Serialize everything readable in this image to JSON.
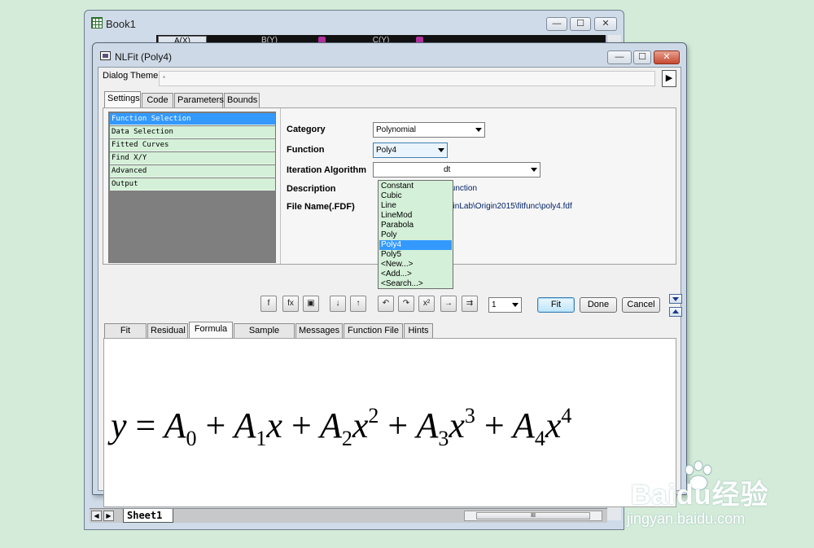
{
  "book1": {
    "title": "Book1",
    "columns": [
      {
        "label": "A(X)"
      },
      {
        "label": "B(Y)"
      },
      {
        "label": "C(Y)"
      }
    ],
    "sheet_tab": "Sheet1",
    "hscroll_thumb": "III",
    "window_buttons": {
      "minimize": "—",
      "maximize": "☐",
      "close": "✕"
    }
  },
  "nlfit": {
    "title": "NLFit (Poly4)",
    "window_buttons": {
      "minimize": "—",
      "maximize": "☐",
      "close": "✕"
    },
    "dialog_theme_label": "Dialog Theme",
    "dialog_theme_value": "*",
    "dialog_theme_arrow": "▶",
    "top_tabs": [
      "Settings",
      "Code",
      "Parameters",
      "Bounds"
    ],
    "tree_items": [
      "Function Selection",
      "Data Selection",
      "Fitted Curves",
      "Find X/Y",
      "Advanced",
      "Output"
    ],
    "fields": {
      "category_label": "Category",
      "category_value": "Polynomial",
      "function_label": "Function",
      "function_value": "Poly4",
      "iteration_label": "Iteration Algorithm",
      "iteration_value_visible": "dt",
      "description_label": "Description",
      "description_value_visible": "function",
      "filename_label": "File Name(.FDF)",
      "filename_value_visible": "ginLab\\Origin2015\\fitfunc\\poly4.fdf"
    },
    "function_options": [
      "Constant",
      "Cubic",
      "Line",
      "LineMod",
      "Parabola",
      "Poly",
      "Poly4",
      "Poly5",
      "<New...>",
      "<Add...>",
      "<Search...>"
    ],
    "selected_function": "Poly4",
    "toolbar_icons": [
      "fx-new-icon",
      "fx-edit-icon",
      "save-icon",
      "sort-down-icon",
      "sort-up-icon",
      "undo-icon",
      "redo-icon",
      "chi-square-icon",
      "step-icon",
      "iterate-icon"
    ],
    "toolbar_icon_text": [
      "f",
      "fx",
      "▣",
      "↓",
      "↑",
      "↶",
      "↷",
      "x²",
      "→",
      "⇉"
    ],
    "iteration_count": "1",
    "buttons": {
      "fit": "Fit",
      "done": "Done",
      "cancel": "Cancel"
    },
    "bottom_tabs": [
      "Fit Curve",
      "Residual",
      "Formula",
      "Sample Curve",
      "Messages",
      "Function File",
      "Hints"
    ],
    "active_bottom_tab": "Formula",
    "formula": {
      "y": "y",
      "eq": "=",
      "terms": [
        {
          "coef": "A",
          "sub": "0",
          "var": "",
          "pow": ""
        },
        {
          "coef": "A",
          "sub": "1",
          "var": "x",
          "pow": ""
        },
        {
          "coef": "A",
          "sub": "2",
          "var": "x",
          "pow": "2"
        },
        {
          "coef": "A",
          "sub": "3",
          "var": "x",
          "pow": "3"
        },
        {
          "coef": "A",
          "sub": "4",
          "var": "x",
          "pow": "4"
        }
      ],
      "plus": "+"
    }
  },
  "watermark": {
    "main": "Baidu经验",
    "sub": "jingyan.baidu.com"
  }
}
